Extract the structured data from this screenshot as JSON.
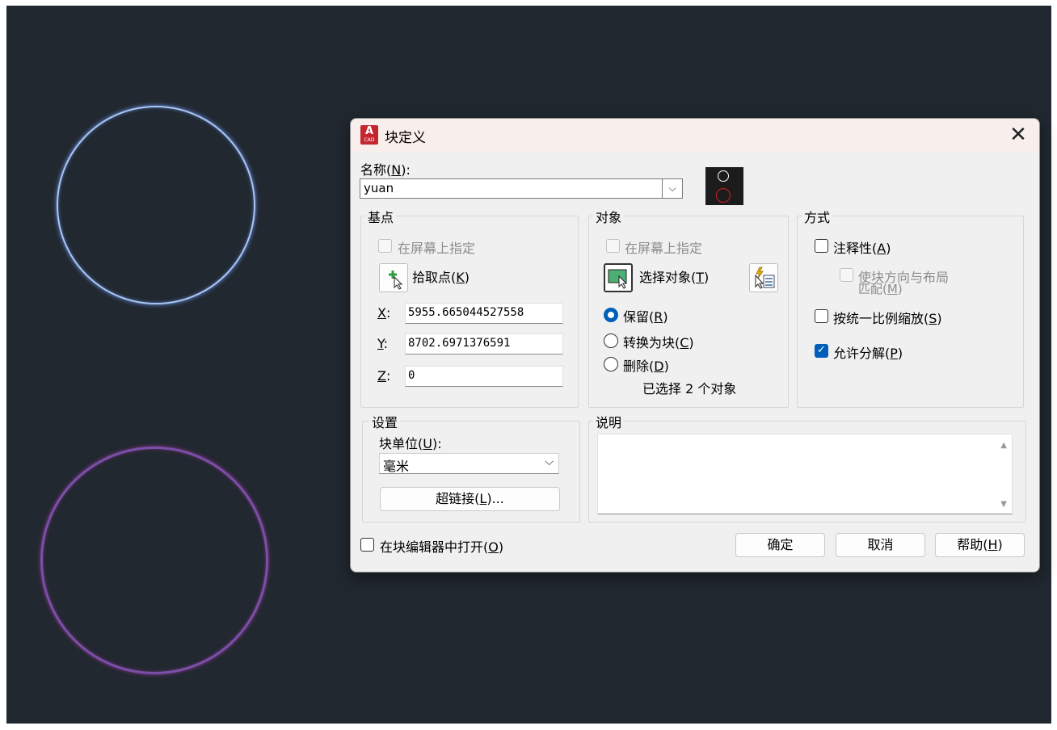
{
  "dialog": {
    "title": "块定义",
    "close_label": "✕",
    "app_icon_letter": "A",
    "app_icon_sub": "CAD"
  },
  "name": {
    "label_prefix": "名称(",
    "label_key": "N",
    "label_suffix": "):",
    "value": "yuan",
    "dropdown_glyph": "⌵"
  },
  "base_point": {
    "title": "基点",
    "specify_on_screen": "在屏幕上指定",
    "pick_prefix": "拾取点(",
    "pick_key": "K",
    "pick_suffix": ")",
    "x_key": "X",
    "y_key": "Y",
    "z_key": "Z",
    "colon": ":",
    "x_value": "5955.665044527558",
    "y_value": "8702.6971376591",
    "z_value": "0"
  },
  "objects": {
    "title": "对象",
    "specify_on_screen": "在屏幕上指定",
    "select_prefix": "选择对象(",
    "select_key": "T",
    "select_suffix": ")",
    "retain_prefix": "保留(",
    "retain_key": "R",
    "retain_suffix": ")",
    "convert_prefix": "转换为块(",
    "convert_key": "C",
    "convert_suffix": ")",
    "delete_prefix": "删除(",
    "delete_key": "D",
    "delete_suffix": ")",
    "selected_info": "已选择 2 个对象",
    "selected_option": "retain"
  },
  "behavior": {
    "title": "方式",
    "annotative_prefix": "注释性(",
    "annotative_key": "A",
    "annotative_suffix": ")",
    "match_line1": "使块方向与布局",
    "match_line2_prefix": "匹配(",
    "match_key": "M",
    "match_suffix": ")",
    "scale_prefix": "按统一比例缩放(",
    "scale_key": "S",
    "scale_suffix": ")",
    "explode_prefix": "允许分解(",
    "explode_key": "P",
    "explode_suffix": ")",
    "annotative_checked": false,
    "scale_uniform_checked": false,
    "allow_explode_checked": true,
    "check_glyph": "✓"
  },
  "settings": {
    "title": "设置",
    "unit_prefix": "块单位(",
    "unit_key": "U",
    "unit_suffix": "):",
    "unit_value": "毫米",
    "dropdown_glyph": "⌵",
    "hyperlink_prefix": "超链接(",
    "hyperlink_key": "L",
    "hyperlink_suffix": ")..."
  },
  "description": {
    "title": "说明",
    "value": "",
    "scroll_up": "▲",
    "scroll_down": "▼"
  },
  "footer": {
    "open_in_editor_prefix": "在块编辑器中打开(",
    "open_in_editor_key": "O",
    "open_in_editor_suffix": ")",
    "open_in_editor_checked": false,
    "ok_label": "确定",
    "cancel_label": "取消",
    "help_prefix": "帮助(",
    "help_key": "H",
    "help_suffix": ")"
  },
  "colors": {
    "canvas": "#212830",
    "top_circle": "#a9c7f5",
    "bottom_circle": "#7a4fa8",
    "accent": "#005fb8",
    "app_icon": "#c4262e"
  }
}
